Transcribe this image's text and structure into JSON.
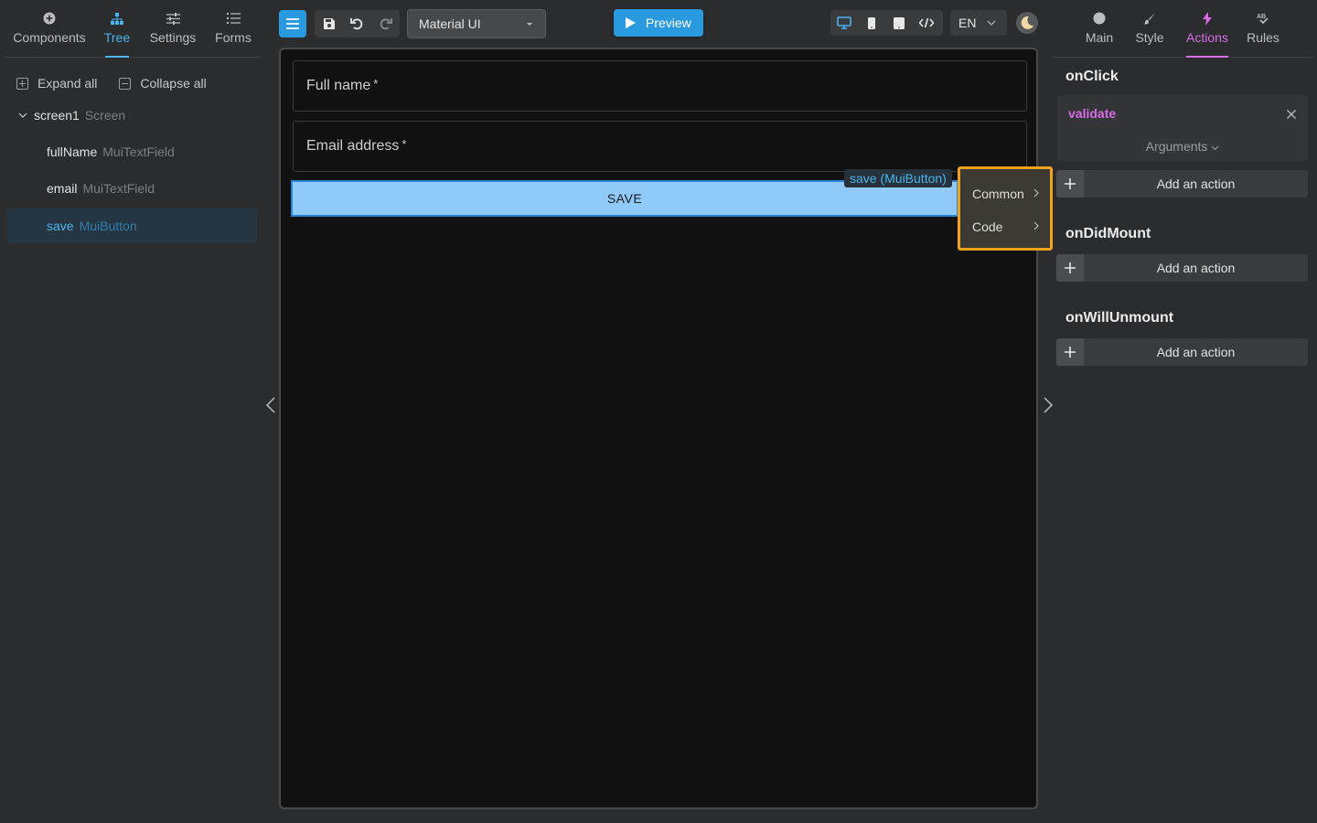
{
  "left_tabs": [
    {
      "label": "Components",
      "icon": "plus-circle-icon"
    },
    {
      "label": "Tree",
      "icon": "sitemap-icon",
      "active": true
    },
    {
      "label": "Settings",
      "icon": "sliders-icon"
    },
    {
      "label": "Forms",
      "icon": "list-icon"
    }
  ],
  "tree": {
    "expand_all": "Expand all",
    "collapse_all": "Collapse all",
    "items": [
      {
        "name": "screen1",
        "type": "Screen"
      },
      {
        "name": "fullName",
        "type": "MuiTextField"
      },
      {
        "name": "email",
        "type": "MuiTextField"
      },
      {
        "name": "save",
        "type": "MuiButton",
        "selected": true
      }
    ]
  },
  "toolbar": {
    "theme_select": "Material UI",
    "preview": "Preview",
    "language": "EN"
  },
  "canvas": {
    "fields": [
      {
        "label": "Full name",
        "required": "*"
      },
      {
        "label": "Email address",
        "required": "*"
      }
    ],
    "save_button": "SAVE",
    "selection_label": "save (MuiButton)",
    "context_menu": [
      "Common",
      "Code"
    ]
  },
  "right_tabs": [
    {
      "label": "Main",
      "icon": "circle-icon"
    },
    {
      "label": "Style",
      "icon": "brush-icon"
    },
    {
      "label": "Actions",
      "icon": "lightning-icon",
      "active": true
    },
    {
      "label": "Rules",
      "icon": "ab-icon"
    }
  ],
  "events": {
    "onclick": {
      "title": "onClick",
      "action": {
        "name": "validate",
        "args": "Arguments"
      },
      "add": "Add an action"
    },
    "didmount": {
      "title": "onDidMount",
      "add": "Add an action"
    },
    "willunmount": {
      "title": "onWillUnmount",
      "add": "Add an action"
    }
  },
  "colors": {
    "accent": "#2a9ae0",
    "actions_accent": "#d86ce8",
    "save_button": "#90caf9",
    "context_menu_border": "#f0a21b"
  }
}
